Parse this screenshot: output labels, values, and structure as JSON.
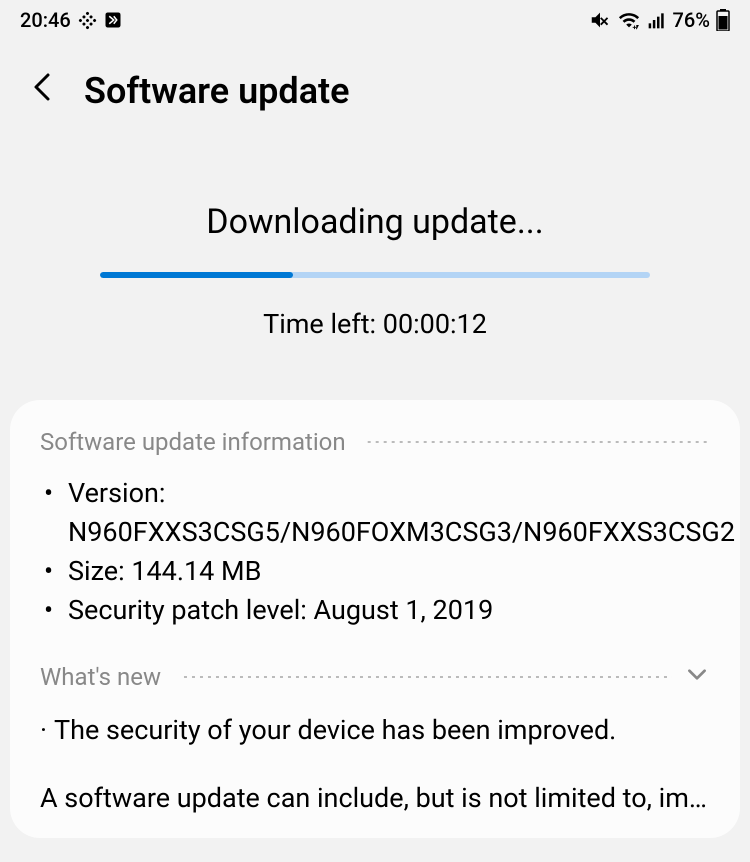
{
  "status_bar": {
    "time": "20:46",
    "battery_percent": "76%"
  },
  "header": {
    "title": "Software update"
  },
  "download": {
    "title": "Downloading update...",
    "progress_percent": 35,
    "time_left": "Time left: 00:00:12"
  },
  "info": {
    "section_title": "Software update information",
    "items": [
      "Version: N960FXXS3CSG5/N960FOXM3CSG3/N960FXXS3CSG2",
      "Size: 144.14 MB",
      "Security patch level: August 1, 2019"
    ]
  },
  "whats_new": {
    "section_title": "What's new",
    "item": "The security of your device has been improved."
  },
  "footer_text": "A software update can include, but is not limited to, improvements"
}
